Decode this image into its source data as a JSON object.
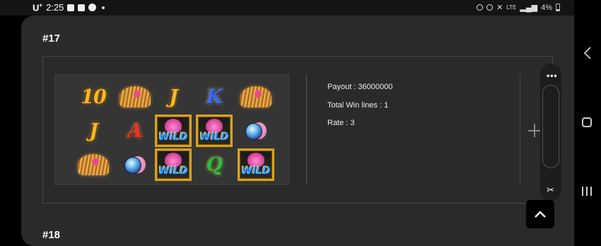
{
  "status_bar": {
    "carrier": "U",
    "carrier_sup": "+",
    "time": "2:25",
    "battery": "4%",
    "lte": "LTE"
  },
  "sections": [
    {
      "heading": "#17"
    },
    {
      "heading": "#18"
    }
  ],
  "result": {
    "payout": "Payout : 36000000",
    "win_lines": "Total Win lines : 1",
    "rate": "Rate : 3"
  },
  "reels": [
    [
      {
        "type": "letter",
        "text": "10",
        "color": "gold"
      },
      {
        "type": "fan"
      },
      {
        "type": "letter",
        "text": "J",
        "color": "gold"
      },
      {
        "type": "letter",
        "text": "K",
        "color": "blue"
      },
      {
        "type": "fan"
      }
    ],
    [
      {
        "type": "letter",
        "text": "J",
        "color": "gold"
      },
      {
        "type": "letter",
        "text": "A",
        "color": "red"
      },
      {
        "type": "wild",
        "text": "WILD"
      },
      {
        "type": "wild",
        "text": "WILD"
      },
      {
        "type": "orb"
      }
    ],
    [
      {
        "type": "fan"
      },
      {
        "type": "orb"
      },
      {
        "type": "wild",
        "text": "WILD"
      },
      {
        "type": "letter",
        "text": "Q",
        "color": "green"
      },
      {
        "type": "wild",
        "text": "WILD"
      }
    ]
  ],
  "edge_panel": {
    "menu_icon": "more-horizontal-icon",
    "tool_icon": "scissors-icon"
  },
  "scroll_top_icon": "chevron-up-icon",
  "nav": {
    "back_icon": "back-icon",
    "home_icon": "home-icon",
    "recent_icon": "recent-apps-icon"
  }
}
